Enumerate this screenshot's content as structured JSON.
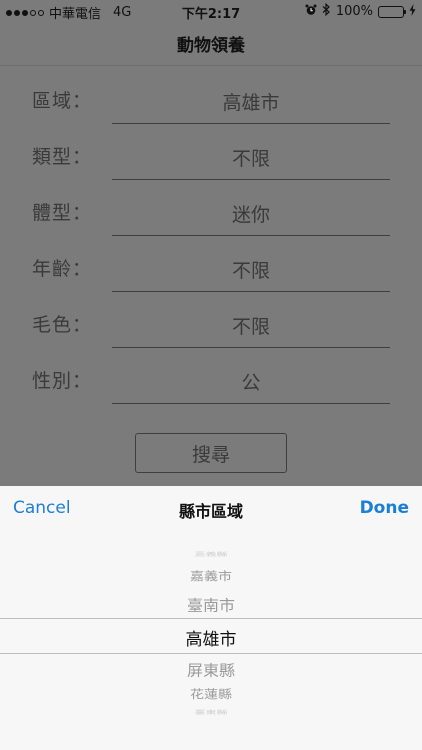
{
  "status_bar": {
    "carrier": "中華電信",
    "network": "4G",
    "time": "下午2:17",
    "battery": "100%",
    "battery_level": 1.0
  },
  "nav": {
    "title": "動物領養"
  },
  "form": {
    "rows": [
      {
        "label": "區域：",
        "value": "高雄市"
      },
      {
        "label": "類型：",
        "value": "不限"
      },
      {
        "label": "體型：",
        "value": "迷你"
      },
      {
        "label": "年齡：",
        "value": "不限"
      },
      {
        "label": "毛色：",
        "value": "不限"
      },
      {
        "label": "性別：",
        "value": "公"
      }
    ],
    "search_label": "搜尋"
  },
  "picker": {
    "cancel_label": "Cancel",
    "title": "縣市區域",
    "done_label": "Done",
    "items": [
      "嘉義縣",
      "嘉義市",
      "臺南市",
      "高雄市",
      "屏東縣",
      "花蓮縣",
      "臺東縣"
    ],
    "selected_index": 3
  },
  "colors": {
    "accent": "#1b7fd6",
    "battery_fill": "#3da84a",
    "overlay_background": "#7b7b7b",
    "sheet_background": "#f7f7f7"
  }
}
